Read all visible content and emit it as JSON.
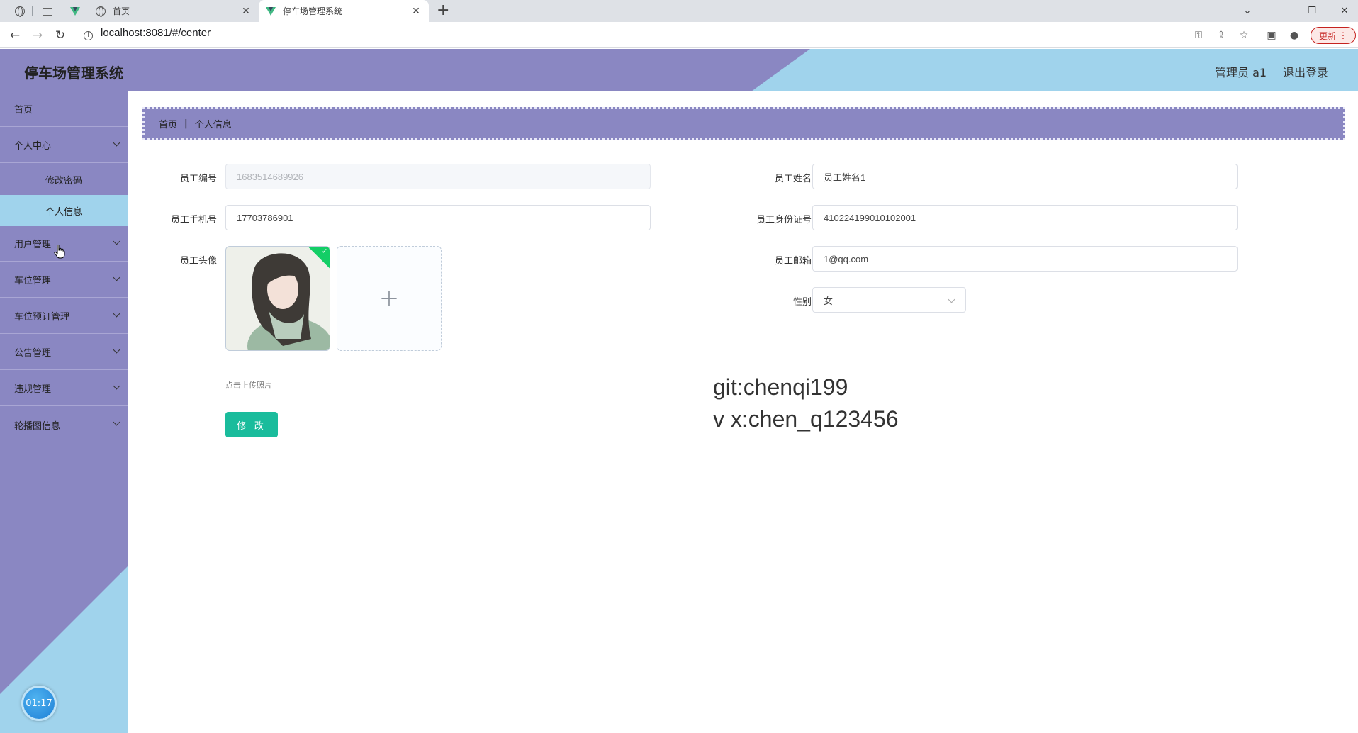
{
  "browser": {
    "tabs": [
      {
        "title": "首页"
      },
      {
        "title": "停车场管理系统"
      }
    ],
    "url": "localhost:8081/#/center",
    "update_label": "更新"
  },
  "header": {
    "title": "停车场管理系统",
    "user": "管理员 a1",
    "logout": "退出登录"
  },
  "sidebar": {
    "home": "首页",
    "personal_center": "个人中心",
    "sub_change_password": "修改密码",
    "sub_personal_info": "个人信息",
    "user_mgmt": "用户管理",
    "space_mgmt": "车位管理",
    "reservation_mgmt": "车位预订管理",
    "notice_mgmt": "公告管理",
    "violation_mgmt": "违规管理",
    "carousel_info": "轮播图信息",
    "timer": "01:17"
  },
  "breadcrumb": {
    "home": "首页",
    "separator": "|",
    "current": "个人信息"
  },
  "form": {
    "employee_id_label": "员工编号",
    "employee_id_value": "1683514689926",
    "employee_name_label": "员工姓名",
    "employee_name_value": "员工姓名1",
    "phone_label": "员工手机号",
    "phone_value": "17703786901",
    "id_card_label": "员工身份证号",
    "id_card_value": "410224199010102001",
    "avatar_label": "员工头像",
    "email_label": "员工邮箱",
    "email_value": "1@qq.com",
    "gender_label": "性别",
    "gender_value": "女",
    "upload_tip": "点击上传照片",
    "submit_label": "修 改"
  },
  "watermark": {
    "line1": "git:chenqi199",
    "line2": "v x:chen_q123456"
  },
  "colors": {
    "purple": "#8a87c2",
    "light_blue": "#a0d3ec",
    "button_green": "#1abc9c"
  }
}
